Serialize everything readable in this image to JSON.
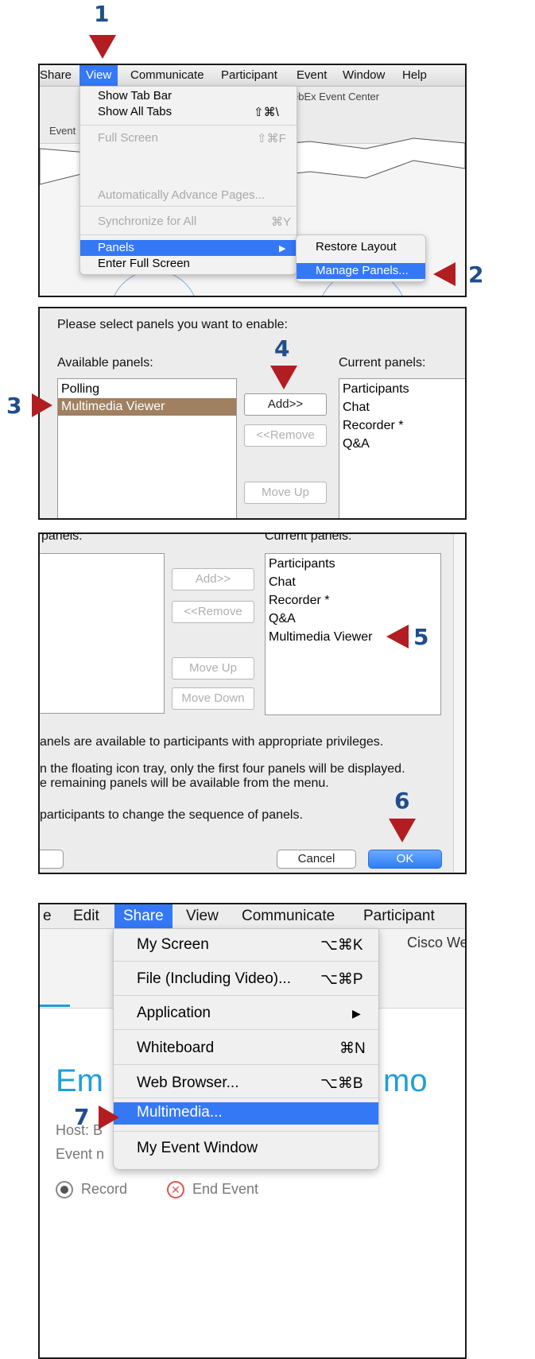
{
  "steps": {
    "s1": "1",
    "s2": "2",
    "s3": "3",
    "s4": "4",
    "s5": "5",
    "s6": "6",
    "s7": "7"
  },
  "panel1": {
    "menubar": [
      "Share",
      "View",
      "Communicate",
      "Participant",
      "Event",
      "Window",
      "Help"
    ],
    "bg_title": "ebEx Event Center",
    "bg_tab": "Event",
    "view_menu": {
      "show_tab_bar": "Show Tab Bar",
      "show_all_tabs": "Show All Tabs",
      "show_all_tabs_shortcut": "⇧⌘\\",
      "full_screen": "Full Screen",
      "full_screen_shortcut": "⇧⌘F",
      "auto_advance": "Automatically Advance Pages...",
      "sync_all": "Synchronize for All",
      "sync_all_shortcut": "⌘Y",
      "panels": "Panels",
      "panels_arrow": "▶",
      "enter_full_screen": "Enter Full Screen"
    },
    "submenu": {
      "restore_layout": "Restore Layout",
      "manage_panels": "Manage Panels..."
    }
  },
  "panel2": {
    "prompt": "Please select panels you want to enable:",
    "available_label": "Available panels:",
    "current_label": "Current panels:",
    "available": [
      "Polling",
      "Multimedia Viewer"
    ],
    "current": [
      "Participants",
      "Chat",
      "Recorder *",
      "Q&A"
    ],
    "add": "Add>>",
    "remove": "<<Remove",
    "move_up": "Move Up"
  },
  "panel3": {
    "available_label_partial": "panels:",
    "current_label": "Current panels:",
    "current": [
      "Participants",
      "Chat",
      "Recorder *",
      "Q&A",
      "Multimedia Viewer"
    ],
    "add": "Add>>",
    "remove": "<<Remove",
    "move_up": "Move Up",
    "move_down": "Move Down",
    "note1": "anels are available to participants with appropriate privileges.",
    "note2": "n the floating icon tray, only the first four panels will be displayed.",
    "note3": "e remaining panels will be available from the menu.",
    "note4": "participants to change the sequence of panels.",
    "cancel": "Cancel",
    "ok": "OK"
  },
  "panel4": {
    "menubar": [
      "e",
      "Edit",
      "Share",
      "View",
      "Communicate",
      "Participant"
    ],
    "bg_title": "Cisco We",
    "bg_heading_left": "Em",
    "bg_heading_right": "mo",
    "host_label": "Host: B",
    "event_label": "Event n",
    "record": "Record",
    "end_event": "End Event",
    "share_menu": {
      "my_screen": "My Screen",
      "my_screen_shortcut": "⌥⌘K",
      "file": "File (Including Video)...",
      "file_shortcut": "⌥⌘P",
      "application": "Application",
      "application_arrow": "▶",
      "whiteboard": "Whiteboard",
      "whiteboard_shortcut": "⌘N",
      "web_browser": "Web Browser...",
      "web_browser_shortcut": "⌥⌘B",
      "multimedia": "Multimedia...",
      "my_event_window": "My Event Window"
    }
  },
  "colors": {
    "accent": "#3478f6",
    "arrow": "#b21d22",
    "step_number": "#1f4e8c",
    "selected_row": "#a08060",
    "heading_blue": "#1e9fd6"
  }
}
